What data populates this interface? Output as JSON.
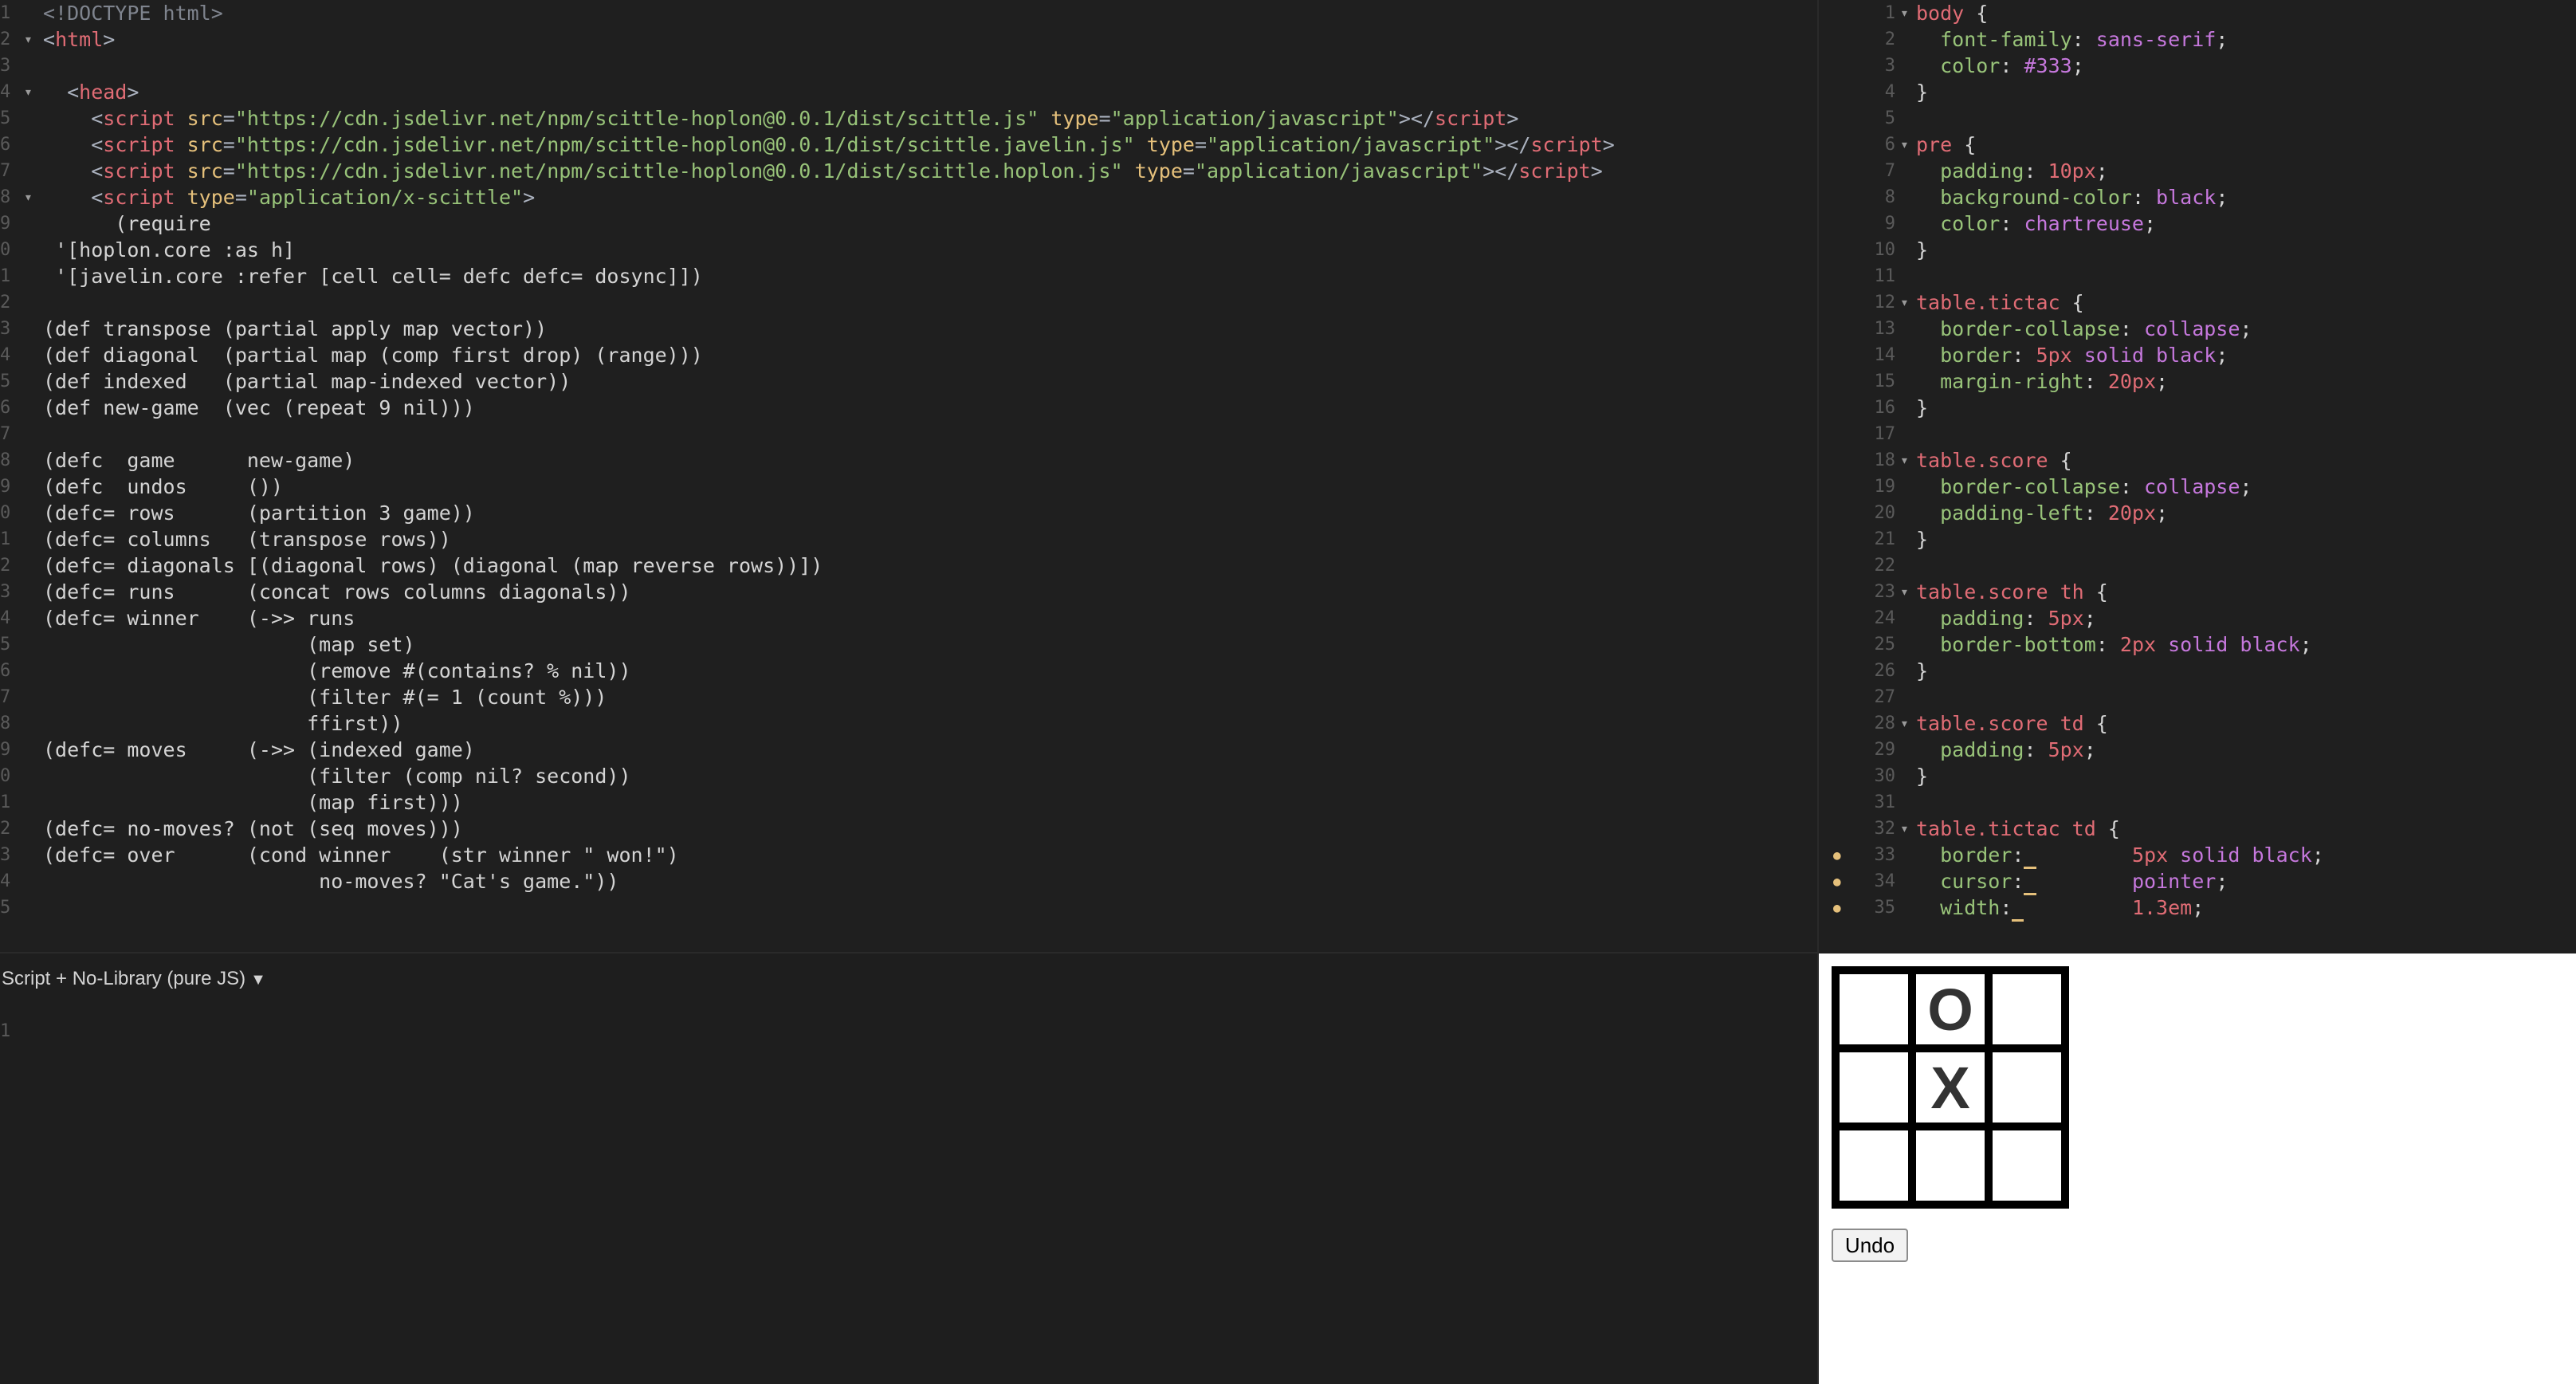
{
  "html_editor": {
    "lines": [
      {
        "n": "1",
        "fold": "",
        "segs": [
          [
            "c-doctype",
            "<!DOCTYPE html>"
          ]
        ]
      },
      {
        "n": "2",
        "fold": "▾",
        "segs": [
          [
            "c-punct",
            "<"
          ],
          [
            "c-tag",
            "html"
          ],
          [
            "c-punct",
            ">"
          ]
        ]
      },
      {
        "n": "3",
        "fold": "",
        "segs": []
      },
      {
        "n": "4",
        "fold": "▾",
        "segs": [
          [
            "c-punct",
            "  <"
          ],
          [
            "c-tag",
            "head"
          ],
          [
            "c-punct",
            ">"
          ]
        ]
      },
      {
        "n": "5",
        "fold": "",
        "segs": [
          [
            "c-punct",
            "    <"
          ],
          [
            "c-tag",
            "script"
          ],
          [
            "c-attr",
            " src"
          ],
          [
            "c-punct",
            "="
          ],
          [
            "c-str",
            "\"https://cdn.jsdelivr.net/npm/scittle-hoplon@0.0.1/dist/scittle.js\""
          ],
          [
            "c-attr",
            " type"
          ],
          [
            "c-punct",
            "="
          ],
          [
            "c-str",
            "\"application/javascript\""
          ],
          [
            "c-punct",
            "></"
          ],
          [
            "c-tag",
            "script"
          ],
          [
            "c-punct",
            ">"
          ]
        ]
      },
      {
        "n": "6",
        "fold": "",
        "segs": [
          [
            "c-punct",
            "    <"
          ],
          [
            "c-tag",
            "script"
          ],
          [
            "c-attr",
            " src"
          ],
          [
            "c-punct",
            "="
          ],
          [
            "c-str",
            "\"https://cdn.jsdelivr.net/npm/scittle-hoplon@0.0.1/dist/scittle.javelin.js\""
          ],
          [
            "c-attr",
            " type"
          ],
          [
            "c-punct",
            "="
          ],
          [
            "c-str",
            "\"application/javascript\""
          ],
          [
            "c-punct",
            "></"
          ],
          [
            "c-tag",
            "script"
          ],
          [
            "c-punct",
            ">"
          ]
        ]
      },
      {
        "n": "7",
        "fold": "",
        "segs": [
          [
            "c-punct",
            "    <"
          ],
          [
            "c-tag",
            "script"
          ],
          [
            "c-attr",
            " src"
          ],
          [
            "c-punct",
            "="
          ],
          [
            "c-str",
            "\"https://cdn.jsdelivr.net/npm/scittle-hoplon@0.0.1/dist/scittle.hoplon.js\""
          ],
          [
            "c-attr",
            " type"
          ],
          [
            "c-punct",
            "="
          ],
          [
            "c-str",
            "\"application/javascript\""
          ],
          [
            "c-punct",
            "></"
          ],
          [
            "c-tag",
            "script"
          ],
          [
            "c-punct",
            ">"
          ]
        ]
      },
      {
        "n": "8",
        "fold": "▾",
        "segs": [
          [
            "c-punct",
            "    <"
          ],
          [
            "c-tag",
            "script"
          ],
          [
            "c-attr",
            " type"
          ],
          [
            "c-punct",
            "="
          ],
          [
            "c-str",
            "\"application/x-scittle\""
          ],
          [
            "c-punct",
            ">"
          ]
        ]
      },
      {
        "n": "9",
        "fold": "",
        "segs": [
          [
            "c-code",
            "      (require"
          ]
        ]
      },
      {
        "n": "0",
        "fold": "",
        "segs": [
          [
            "c-code",
            " '[hoplon.core :as h]"
          ]
        ]
      },
      {
        "n": "1",
        "fold": "",
        "segs": [
          [
            "c-code",
            " '[javelin.core :refer [cell cell= defc defc= dosync]])"
          ]
        ]
      },
      {
        "n": "2",
        "fold": "",
        "segs": []
      },
      {
        "n": "3",
        "fold": "",
        "segs": [
          [
            "c-code",
            "(def transpose (partial apply map vector))"
          ]
        ]
      },
      {
        "n": "4",
        "fold": "",
        "segs": [
          [
            "c-code",
            "(def diagonal  (partial map (comp first drop) (range)))"
          ]
        ]
      },
      {
        "n": "5",
        "fold": "",
        "segs": [
          [
            "c-code",
            "(def indexed   (partial map-indexed vector))"
          ]
        ]
      },
      {
        "n": "6",
        "fold": "",
        "segs": [
          [
            "c-code",
            "(def new-game  (vec (repeat 9 nil)))"
          ]
        ]
      },
      {
        "n": "7",
        "fold": "",
        "segs": []
      },
      {
        "n": "8",
        "fold": "",
        "segs": [
          [
            "c-code",
            "(defc  game      new-game)"
          ]
        ]
      },
      {
        "n": "9",
        "fold": "",
        "segs": [
          [
            "c-code",
            "(defc  undos     ())"
          ]
        ]
      },
      {
        "n": "0",
        "fold": "",
        "segs": [
          [
            "c-code",
            "(defc= rows      (partition 3 game))"
          ]
        ]
      },
      {
        "n": "1",
        "fold": "",
        "segs": [
          [
            "c-code",
            "(defc= columns   (transpose rows))"
          ]
        ]
      },
      {
        "n": "2",
        "fold": "",
        "segs": [
          [
            "c-code",
            "(defc= diagonals [(diagonal rows) (diagonal (map reverse rows))])"
          ]
        ]
      },
      {
        "n": "3",
        "fold": "",
        "segs": [
          [
            "c-code",
            "(defc= runs      (concat rows columns diagonals))"
          ]
        ]
      },
      {
        "n": "4",
        "fold": "",
        "segs": [
          [
            "c-code",
            "(defc= winner    (->> runs"
          ]
        ]
      },
      {
        "n": "5",
        "fold": "",
        "segs": [
          [
            "c-code",
            "                      (map set)"
          ]
        ]
      },
      {
        "n": "6",
        "fold": "",
        "segs": [
          [
            "c-code",
            "                      (remove #(contains? % nil))"
          ]
        ]
      },
      {
        "n": "7",
        "fold": "",
        "segs": [
          [
            "c-code",
            "                      (filter #(= 1 (count %)))"
          ]
        ]
      },
      {
        "n": "8",
        "fold": "",
        "segs": [
          [
            "c-code",
            "                      ffirst))"
          ]
        ]
      },
      {
        "n": "9",
        "fold": "",
        "segs": [
          [
            "c-code",
            "(defc= moves     (->> (indexed game)"
          ]
        ]
      },
      {
        "n": "0",
        "fold": "",
        "segs": [
          [
            "c-code",
            "                      (filter (comp nil? second))"
          ]
        ]
      },
      {
        "n": "1",
        "fold": "",
        "segs": [
          [
            "c-code",
            "                      (map first)))"
          ]
        ]
      },
      {
        "n": "2",
        "fold": "",
        "segs": [
          [
            "c-code",
            "(defc= no-moves? (not (seq moves)))"
          ]
        ]
      },
      {
        "n": "3",
        "fold": "",
        "segs": [
          [
            "c-code",
            "(defc= over      (cond winner    (str winner \" won!\")"
          ]
        ]
      },
      {
        "n": "4",
        "fold": "",
        "segs": [
          [
            "c-code",
            "                       no-moves? \"Cat's game.\"))"
          ]
        ]
      },
      {
        "n": "5",
        "fold": "",
        "segs": []
      }
    ]
  },
  "css_editor": {
    "lines": [
      {
        "n": "1",
        "fold": "▾",
        "dot": false,
        "segs": [
          [
            "c-sel",
            "body"
          ],
          [
            "c-brace",
            " {"
          ]
        ]
      },
      {
        "n": "2",
        "fold": "",
        "dot": false,
        "segs": [
          [
            "c-prop",
            "  font-family"
          ],
          [
            "c-brace",
            ": "
          ],
          [
            "c-kw",
            "sans-serif"
          ],
          [
            "c-brace",
            ";"
          ]
        ]
      },
      {
        "n": "3",
        "fold": "",
        "dot": false,
        "segs": [
          [
            "c-prop",
            "  color"
          ],
          [
            "c-brace",
            ": "
          ],
          [
            "c-kw",
            "#333"
          ],
          [
            "c-brace",
            ";"
          ]
        ]
      },
      {
        "n": "4",
        "fold": "",
        "dot": false,
        "segs": [
          [
            "c-brace",
            "}"
          ]
        ]
      },
      {
        "n": "5",
        "fold": "",
        "dot": false,
        "segs": []
      },
      {
        "n": "6",
        "fold": "▾",
        "dot": false,
        "segs": [
          [
            "c-sel",
            "pre"
          ],
          [
            "c-brace",
            " {"
          ]
        ]
      },
      {
        "n": "7",
        "fold": "",
        "dot": false,
        "segs": [
          [
            "c-prop",
            "  padding"
          ],
          [
            "c-brace",
            ": "
          ],
          [
            "c-num",
            "10px"
          ],
          [
            "c-brace",
            ";"
          ]
        ]
      },
      {
        "n": "8",
        "fold": "",
        "dot": false,
        "segs": [
          [
            "c-prop",
            "  background-color"
          ],
          [
            "c-brace",
            ": "
          ],
          [
            "c-kw",
            "black"
          ],
          [
            "c-brace",
            ";"
          ]
        ]
      },
      {
        "n": "9",
        "fold": "",
        "dot": false,
        "segs": [
          [
            "c-prop",
            "  color"
          ],
          [
            "c-brace",
            ": "
          ],
          [
            "c-kw",
            "chartreuse"
          ],
          [
            "c-brace",
            ";"
          ]
        ]
      },
      {
        "n": "10",
        "fold": "",
        "dot": false,
        "segs": [
          [
            "c-brace",
            "}"
          ]
        ]
      },
      {
        "n": "11",
        "fold": "",
        "dot": false,
        "segs": []
      },
      {
        "n": "12",
        "fold": "▾",
        "dot": false,
        "segs": [
          [
            "c-sel",
            "table.tictac"
          ],
          [
            "c-brace",
            " {"
          ]
        ]
      },
      {
        "n": "13",
        "fold": "",
        "dot": false,
        "segs": [
          [
            "c-prop",
            "  border-collapse"
          ],
          [
            "c-brace",
            ": "
          ],
          [
            "c-kw",
            "collapse"
          ],
          [
            "c-brace",
            ";"
          ]
        ]
      },
      {
        "n": "14",
        "fold": "",
        "dot": false,
        "segs": [
          [
            "c-prop",
            "  border"
          ],
          [
            "c-brace",
            ": "
          ],
          [
            "c-num",
            "5px"
          ],
          [
            "c-kw",
            " solid black"
          ],
          [
            "c-brace",
            ";"
          ]
        ]
      },
      {
        "n": "15",
        "fold": "",
        "dot": false,
        "segs": [
          [
            "c-prop",
            "  margin-right"
          ],
          [
            "c-brace",
            ": "
          ],
          [
            "c-num",
            "20px"
          ],
          [
            "c-brace",
            ";"
          ]
        ]
      },
      {
        "n": "16",
        "fold": "",
        "dot": false,
        "segs": [
          [
            "c-brace",
            "}"
          ]
        ]
      },
      {
        "n": "17",
        "fold": "",
        "dot": false,
        "segs": []
      },
      {
        "n": "18",
        "fold": "▾",
        "dot": false,
        "segs": [
          [
            "c-sel",
            "table.score"
          ],
          [
            "c-brace",
            " {"
          ]
        ]
      },
      {
        "n": "19",
        "fold": "",
        "dot": false,
        "segs": [
          [
            "c-prop",
            "  border-collapse"
          ],
          [
            "c-brace",
            ": "
          ],
          [
            "c-kw",
            "collapse"
          ],
          [
            "c-brace",
            ";"
          ]
        ]
      },
      {
        "n": "20",
        "fold": "",
        "dot": false,
        "segs": [
          [
            "c-prop",
            "  padding-left"
          ],
          [
            "c-brace",
            ": "
          ],
          [
            "c-num",
            "20px"
          ],
          [
            "c-brace",
            ";"
          ]
        ]
      },
      {
        "n": "21",
        "fold": "",
        "dot": false,
        "segs": [
          [
            "c-brace",
            "}"
          ]
        ]
      },
      {
        "n": "22",
        "fold": "",
        "dot": false,
        "segs": []
      },
      {
        "n": "23",
        "fold": "▾",
        "dot": false,
        "segs": [
          [
            "c-sel",
            "table.score th"
          ],
          [
            "c-brace",
            " {"
          ]
        ]
      },
      {
        "n": "24",
        "fold": "",
        "dot": false,
        "segs": [
          [
            "c-prop",
            "  padding"
          ],
          [
            "c-brace",
            ": "
          ],
          [
            "c-num",
            "5px"
          ],
          [
            "c-brace",
            ";"
          ]
        ]
      },
      {
        "n": "25",
        "fold": "",
        "dot": false,
        "segs": [
          [
            "c-prop",
            "  border-bottom"
          ],
          [
            "c-brace",
            ": "
          ],
          [
            "c-num",
            "2px"
          ],
          [
            "c-kw",
            " solid black"
          ],
          [
            "c-brace",
            ";"
          ]
        ]
      },
      {
        "n": "26",
        "fold": "",
        "dot": false,
        "segs": [
          [
            "c-brace",
            "}"
          ]
        ]
      },
      {
        "n": "27",
        "fold": "",
        "dot": false,
        "segs": []
      },
      {
        "n": "28",
        "fold": "▾",
        "dot": false,
        "segs": [
          [
            "c-sel",
            "table.score td"
          ],
          [
            "c-brace",
            " {"
          ]
        ]
      },
      {
        "n": "29",
        "fold": "",
        "dot": false,
        "segs": [
          [
            "c-prop",
            "  padding"
          ],
          [
            "c-brace",
            ": "
          ],
          [
            "c-num",
            "5px"
          ],
          [
            "c-brace",
            ";"
          ]
        ]
      },
      {
        "n": "30",
        "fold": "",
        "dot": false,
        "segs": [
          [
            "c-brace",
            "}"
          ]
        ]
      },
      {
        "n": "31",
        "fold": "",
        "dot": false,
        "segs": []
      },
      {
        "n": "32",
        "fold": "▾",
        "dot": false,
        "segs": [
          [
            "c-sel",
            "table.tictac td"
          ],
          [
            "c-brace",
            " {"
          ]
        ]
      },
      {
        "n": "33",
        "fold": "",
        "dot": true,
        "segs": [
          [
            "c-prop",
            "  border"
          ],
          [
            "c-brace",
            ":"
          ],
          [
            "cursor-mark",
            " "
          ],
          [
            "c-brace",
            "        "
          ],
          [
            "c-num",
            "5px"
          ],
          [
            "c-kw",
            " solid black"
          ],
          [
            "c-brace",
            ";"
          ]
        ]
      },
      {
        "n": "34",
        "fold": "",
        "dot": true,
        "segs": [
          [
            "c-prop",
            "  cursor"
          ],
          [
            "c-brace",
            ":"
          ],
          [
            "cursor-mark",
            " "
          ],
          [
            "c-brace",
            "        "
          ],
          [
            "c-kw",
            "pointer"
          ],
          [
            "c-brace",
            ";"
          ]
        ]
      },
      {
        "n": "35",
        "fold": "",
        "dot": true,
        "segs": [
          [
            "c-prop",
            "  width"
          ],
          [
            "c-brace",
            ":"
          ],
          [
            "cursor-mark",
            " "
          ],
          [
            "c-brace",
            "         "
          ],
          [
            "c-num",
            "1.3em"
          ],
          [
            "c-brace",
            ";"
          ]
        ]
      }
    ]
  },
  "js_editor": {
    "language_label": "Script + No-Library (pure JS)",
    "caret_icon": "caret-down-icon",
    "line_number": "1"
  },
  "preview": {
    "board": [
      [
        "",
        "O",
        ""
      ],
      [
        "",
        "X",
        ""
      ],
      [
        "",
        "",
        ""
      ]
    ],
    "undo_label": "Undo"
  }
}
